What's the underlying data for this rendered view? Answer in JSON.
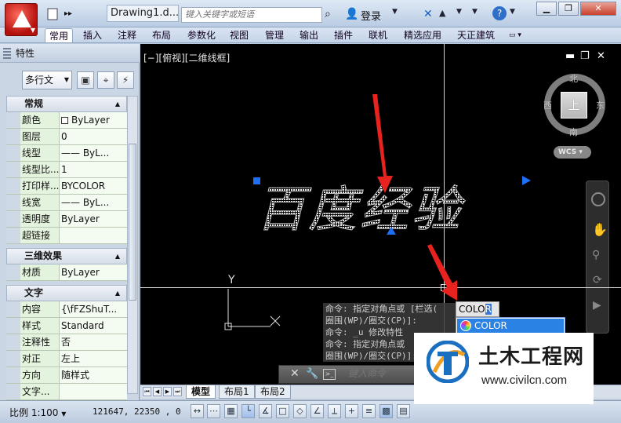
{
  "titlebar": {
    "doc_title": "Drawing1.d...",
    "search_placeholder": "键入关键字或短语",
    "login_label": "登录"
  },
  "ribbon_tabs": [
    "常用",
    "插入",
    "注释",
    "布局",
    "参数化",
    "视图",
    "管理",
    "输出",
    "插件",
    "联机",
    "精选应用",
    "天正建筑"
  ],
  "palette": {
    "title": "特性",
    "object_type": "多行文",
    "sections": [
      {
        "name": "常规",
        "rows": [
          {
            "label": "颜色",
            "value": "ByLayer",
            "swatch": true
          },
          {
            "label": "图层",
            "value": "0"
          },
          {
            "label": "线型",
            "value": "—— ByL..."
          },
          {
            "label": "线型比...",
            "value": "1"
          },
          {
            "label": "打印样...",
            "value": "BYCOLOR"
          },
          {
            "label": "线宽",
            "value": "—— ByL..."
          },
          {
            "label": "透明度",
            "value": "ByLayer"
          },
          {
            "label": "超链接",
            "value": ""
          }
        ]
      },
      {
        "name": "三维效果",
        "rows": [
          {
            "label": "材质",
            "value": "ByLayer"
          }
        ]
      },
      {
        "name": "文字",
        "rows": [
          {
            "label": "内容",
            "value": "{\\fFZShuT..."
          },
          {
            "label": "样式",
            "value": "Standard"
          },
          {
            "label": "注释性",
            "value": "否"
          },
          {
            "label": "对正",
            "value": "左上"
          },
          {
            "label": "方向",
            "value": "随样式"
          },
          {
            "label": "文字...",
            "value": ""
          }
        ]
      }
    ]
  },
  "canvas": {
    "viewport_label": "[−][俯视][二维线框]",
    "compass": {
      "north": "北",
      "south": "南",
      "east": "东",
      "west": "西"
    },
    "cube_face": "上",
    "wcs_label": "WCS",
    "drawing_text": "百度经验",
    "ucs_y_label": "Y"
  },
  "command": {
    "history": [
      "命令: 指定对角点或 [栏选(",
      "圈围(WP)/圈交(CP)]:",
      "命令: _u 修改特性",
      "命令: 指定对角点或",
      "圈围(WP)/圈交(CP)]:"
    ],
    "typed_text": "COLO",
    "typed_caret": "R",
    "autocomplete_item": "COLOR",
    "input_placeholder": "键入命令"
  },
  "layout_tabs": [
    "模型",
    "布局1",
    "布局2"
  ],
  "statusbar": {
    "scale": "比例 1:100",
    "coordinates": "121647, 22350 , 0"
  },
  "watermark": {
    "name": "土木工程网",
    "url": "www.civilcn.com"
  },
  "colors": {
    "canvas_bg": "#000000",
    "grip_blue": "#1e6ff5",
    "highlight_blue": "#2a82e4",
    "annotation_red": "#e8231f",
    "property_green": "#e4f3dd"
  }
}
